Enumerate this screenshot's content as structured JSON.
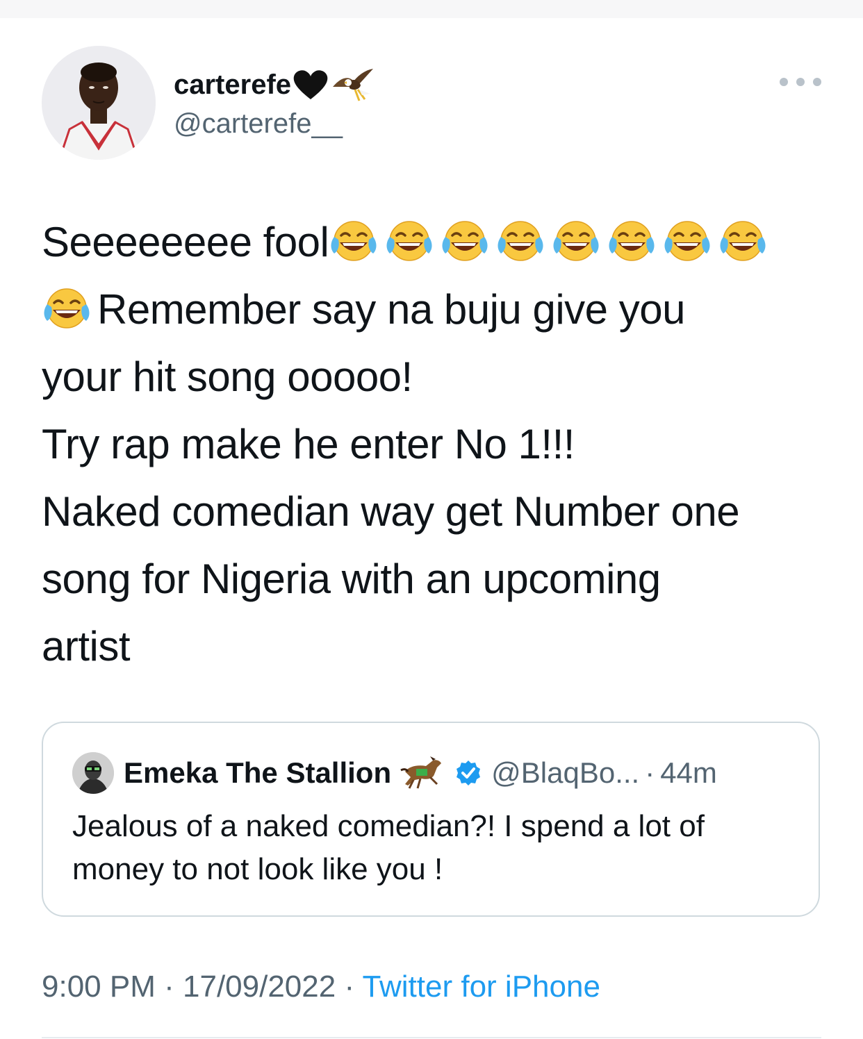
{
  "author": {
    "display_name": "carterefe",
    "handle": "@carterefe__",
    "name_icons": [
      "black-heart-icon",
      "eagle-icon"
    ]
  },
  "tweet": {
    "lines": [
      "Seeeeeeee fool",
      "Remember say na buju give you",
      "your hit song ooooo!",
      "Try rap make he enter No 1!!!",
      "Naked comedian way get Number one",
      "song for Nigeria with an upcoming",
      "artist"
    ],
    "emoji": "face-with-tears-of-joy-icon",
    "emoji_count_line1": 8,
    "emoji_count_line2": 1
  },
  "quote": {
    "display_name": "Emeka The Stallion",
    "name_icons": [
      "racehorse-icon",
      "verified-badge-icon"
    ],
    "handle": "@BlaqBo...",
    "separator": "·",
    "time": "44m",
    "text": "Jealous of a naked comedian?! I spend a lot of money to not look like you !"
  },
  "footer": {
    "time": "9:00 PM",
    "separator": "·",
    "date": "17/09/2022",
    "separator2": "·",
    "source": "Twitter for iPhone"
  },
  "colors": {
    "text": "#0f1419",
    "secondary": "#536471",
    "link": "#1d9bf0",
    "border": "#cfd9de",
    "verified": "#1d9bf0"
  }
}
